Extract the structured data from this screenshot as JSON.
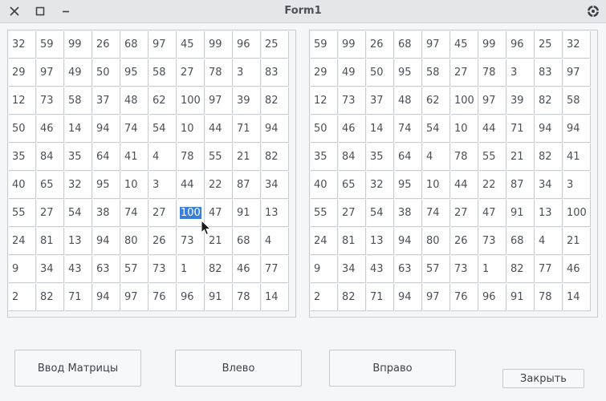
{
  "window": {
    "title": "Form1"
  },
  "titlebar_icons": {
    "close": "close-icon",
    "maximize": "maximize-icon",
    "minimize": "minimize-icon",
    "app": "app-menu-icon"
  },
  "left_matrix": [
    [
      "32",
      "59",
      "99",
      "26",
      "68",
      "97",
      "45",
      "99",
      "96",
      "25"
    ],
    [
      "29",
      "97",
      "49",
      "50",
      "95",
      "58",
      "27",
      "78",
      "3",
      "83"
    ],
    [
      "12",
      "73",
      "58",
      "37",
      "48",
      "62",
      "100",
      "97",
      "39",
      "82"
    ],
    [
      "50",
      "46",
      "14",
      "94",
      "74",
      "54",
      "10",
      "44",
      "71",
      "94"
    ],
    [
      "35",
      "84",
      "35",
      "64",
      "41",
      "4",
      "78",
      "55",
      "21",
      "82"
    ],
    [
      "40",
      "65",
      "32",
      "95",
      "10",
      "3",
      "44",
      "22",
      "87",
      "34"
    ],
    [
      "55",
      "27",
      "54",
      "38",
      "74",
      "27",
      "100",
      "47",
      "91",
      "13"
    ],
    [
      "24",
      "81",
      "13",
      "94",
      "80",
      "26",
      "73",
      "21",
      "68",
      "4"
    ],
    [
      "9",
      "34",
      "43",
      "63",
      "57",
      "73",
      "1",
      "82",
      "46",
      "77"
    ],
    [
      "2",
      "82",
      "71",
      "94",
      "97",
      "76",
      "96",
      "91",
      "78",
      "14"
    ]
  ],
  "right_matrix": [
    [
      "59",
      "99",
      "26",
      "68",
      "97",
      "45",
      "99",
      "96",
      "25",
      "32"
    ],
    [
      "29",
      "49",
      "50",
      "95",
      "58",
      "27",
      "78",
      "3",
      "83",
      "97"
    ],
    [
      "12",
      "73",
      "37",
      "48",
      "62",
      "100",
      "97",
      "39",
      "82",
      "58"
    ],
    [
      "50",
      "46",
      "14",
      "74",
      "54",
      "10",
      "44",
      "71",
      "94",
      "94"
    ],
    [
      "35",
      "84",
      "35",
      "64",
      "4",
      "78",
      "55",
      "21",
      "82",
      "41"
    ],
    [
      "40",
      "65",
      "32",
      "95",
      "10",
      "44",
      "22",
      "87",
      "34",
      "3"
    ],
    [
      "55",
      "27",
      "54",
      "38",
      "74",
      "27",
      "47",
      "91",
      "13",
      "100"
    ],
    [
      "24",
      "81",
      "13",
      "94",
      "80",
      "26",
      "73",
      "68",
      "4",
      "21"
    ],
    [
      "9",
      "34",
      "43",
      "63",
      "57",
      "73",
      "1",
      "82",
      "77",
      "46"
    ],
    [
      "2",
      "82",
      "71",
      "94",
      "97",
      "76",
      "96",
      "91",
      "78",
      "14"
    ]
  ],
  "selected_cell": {
    "grid": "left",
    "row": 6,
    "col": 6
  },
  "buttons": {
    "input_matrix": "Ввод Матрицы",
    "left": "Влево",
    "right": "Вправо",
    "close": "Закрыть"
  },
  "colors": {
    "selection": "#3d7fd6",
    "grid_line": "#c9ccd0"
  }
}
